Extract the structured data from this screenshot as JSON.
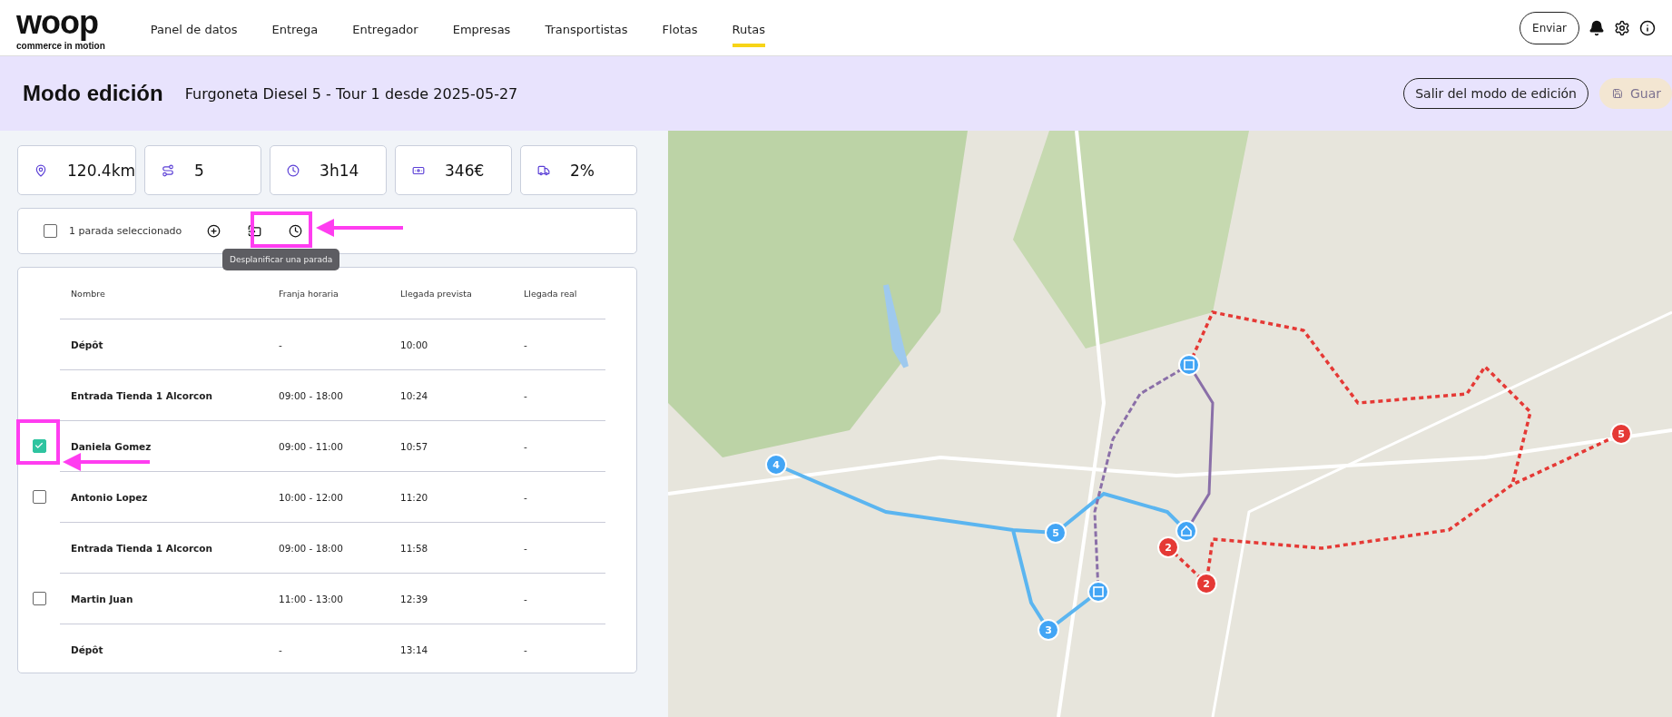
{
  "logo": {
    "name": "woop",
    "tagline": "commerce in motion"
  },
  "nav": [
    {
      "label": "Panel de datos",
      "selected": false
    },
    {
      "label": "Entrega",
      "selected": false
    },
    {
      "label": "Entregador",
      "selected": false
    },
    {
      "label": "Empresas",
      "selected": false
    },
    {
      "label": "Transportistas",
      "selected": false
    },
    {
      "label": "Flotas",
      "selected": false
    },
    {
      "label": "Rutas",
      "selected": true
    }
  ],
  "header_actions": {
    "send_button": "Enviar"
  },
  "edit_banner": {
    "title": "Modo edición",
    "subtitle": "Furgoneta Diesel 5 - Tour 1 desde 2025-05-27",
    "exit_button": "Salir del modo de edición",
    "save_button": {
      "label": "Guar",
      "disabled": true
    }
  },
  "stats": [
    {
      "kind": "distance",
      "value": "120.4km"
    },
    {
      "kind": "stops",
      "value": "5"
    },
    {
      "kind": "time",
      "value": "3h14"
    },
    {
      "kind": "cost",
      "value": "346€"
    },
    {
      "kind": "load",
      "value": "2%"
    }
  ],
  "selection_bar": {
    "checked": false,
    "label": "1 parada seleccionado",
    "tooltip": "Desplanificar una parada"
  },
  "table": {
    "columns": [
      "Nombre",
      "Franja horaria",
      "Llegada prevista",
      "Llegada real"
    ],
    "rows": [
      {
        "kind": "depot",
        "name": "Dépôt",
        "window": "-",
        "eta": "10:00",
        "actual": "-"
      },
      {
        "kind": "depot",
        "name": "Entrada Tienda 1 Alcorcon",
        "window": "09:00 - 18:00",
        "eta": "10:24",
        "actual": "-"
      },
      {
        "kind": "stop",
        "checked": true,
        "name": "Daniela Gomez",
        "window": "09:00 - 11:00",
        "eta": "10:57",
        "actual": "-"
      },
      {
        "kind": "stop",
        "checked": false,
        "name": "Antonio Lopez",
        "window": "10:00 - 12:00",
        "eta": "11:20",
        "actual": "-"
      },
      {
        "kind": "depot",
        "name": "Entrada Tienda 1 Alcorcon",
        "window": "09:00 - 18:00",
        "eta": "11:58",
        "actual": "-"
      },
      {
        "kind": "stop",
        "checked": false,
        "name": "Martin Juan",
        "window": "11:00 - 13:00",
        "eta": "12:39",
        "actual": "-"
      },
      {
        "kind": "depot",
        "name": "Dépôt",
        "window": "-",
        "eta": "13:14",
        "actual": "-"
      }
    ]
  },
  "map": {
    "markers": [
      {
        "kind": "number",
        "label": "4",
        "color": "#42a5f5"
      },
      {
        "kind": "number",
        "label": "5",
        "color": "#42a5f5"
      },
      {
        "kind": "number",
        "label": "3",
        "color": "#42a5f5"
      },
      {
        "kind": "number",
        "label": "2",
        "color": "#e53935"
      },
      {
        "kind": "number",
        "label": "2",
        "color": "#e53935"
      },
      {
        "kind": "number",
        "label": "5",
        "color": "#e53935"
      },
      {
        "kind": "package",
        "color": "#42a5f5"
      },
      {
        "kind": "package",
        "color": "#42a5f5"
      },
      {
        "kind": "home",
        "color": "#42a5f5"
      }
    ]
  }
}
